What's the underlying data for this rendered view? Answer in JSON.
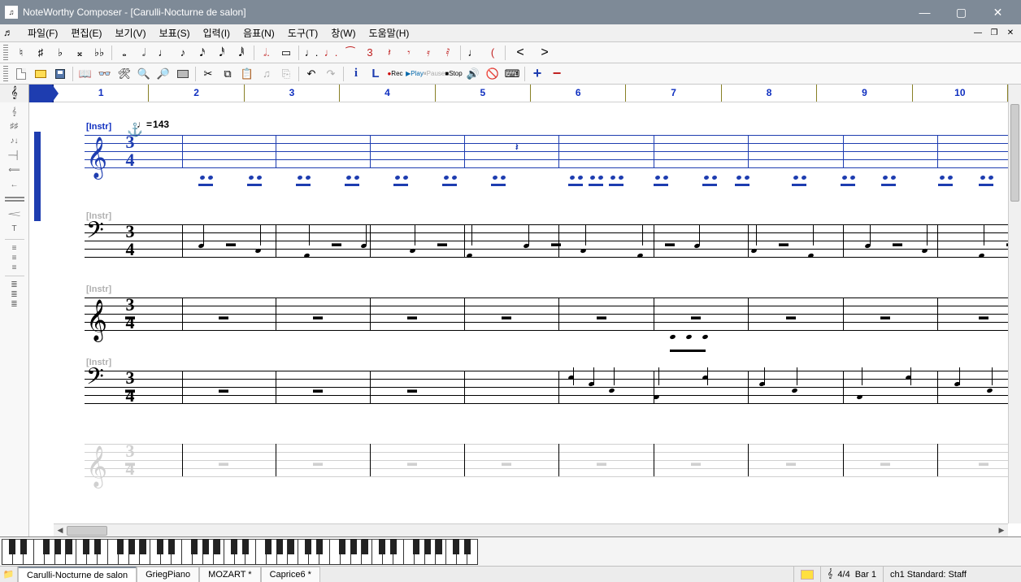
{
  "window": {
    "title": "NoteWorthy Composer - [Carulli-Nocturne de salon]"
  },
  "menu": {
    "items": [
      "파일(F)",
      "편집(E)",
      "보기(V)",
      "보표(S)",
      "입력(I)",
      "음표(N)",
      "도구(T)",
      "창(W)",
      "도움말(H)"
    ]
  },
  "notation_toolbar": {
    "natural": "♮",
    "sharp": "♯",
    "flat": "♭",
    "dbl_sharp": "𝄪",
    "dbl_flat": "♭♭",
    "whole_note": "𝅝",
    "half_note": "𝅗𝅥",
    "quarter_note": "♩",
    "eighth_note": "♪",
    "sixteenth_note": "𝅘𝅥𝅯",
    "thirtysecond_note": "𝅘𝅥𝅰",
    "sixtyfourth_note": "𝅘𝅥𝅱",
    "dot_half": "𝅗𝅥.",
    "rect": "▭",
    "dotted_q": "♩.",
    "dotted_q_red": "♩.",
    "tie": "⁀",
    "triplet": "3",
    "rest1": "𝄽",
    "rest2": "𝄾",
    "rest3": "𝄿",
    "rest4": "𝅀",
    "slur_up": "(",
    "accent": ">",
    "cresc": "<",
    "decresc": ">"
  },
  "file_toolbar": {
    "new": "new",
    "open": "open",
    "save": "save",
    "book": "📖",
    "glasses": "👓",
    "tools": "🛠",
    "find": "🔍",
    "find_page": "🔎",
    "print": "print",
    "cut": "✂",
    "copy": "⧉",
    "paste": "📋",
    "note_entry": "♫",
    "link": "⎘",
    "undo": "↶",
    "redo": "↷",
    "info": "i",
    "L": "L",
    "Rec": "Rec",
    "Play": "Play",
    "Pause": "Pause",
    "Stop": "Stop",
    "speaker": "🔊",
    "mute": "🚫",
    "piano_icon": "⌨",
    "plus": "+",
    "minus": "−"
  },
  "ruler": {
    "measures": [
      "1",
      "2",
      "3",
      "4",
      "5",
      "6",
      "7",
      "8",
      "9",
      "10"
    ]
  },
  "score": {
    "tempo": "143",
    "staves": [
      {
        "label": "[Instr]",
        "clef": "treble",
        "time_top": "3",
        "time_bot": "4",
        "selected": true
      },
      {
        "label": "[Instr]",
        "clef": "bass",
        "time_top": "3",
        "time_bot": "4",
        "selected": false
      },
      {
        "label": "[Instr]",
        "clef": "treble",
        "time_top": "3",
        "time_bot": "4",
        "selected": false
      },
      {
        "label": "[Instr]",
        "clef": "bass",
        "time_top": "3",
        "time_bot": "4",
        "selected": false
      },
      {
        "label": "",
        "clef": "treble",
        "time_top": "3",
        "time_bot": "4",
        "selected": false,
        "ghost": true
      }
    ]
  },
  "tabs": {
    "icon": "📁",
    "docs": [
      {
        "name": "Carulli-Nocturne de salon",
        "modified": false,
        "active": true
      },
      {
        "name": "GriegPiano",
        "modified": false,
        "active": false
      },
      {
        "name": "MOZART *",
        "modified": true,
        "active": false
      },
      {
        "name": "Caprice6 *",
        "modified": true,
        "active": false
      }
    ]
  },
  "status": {
    "time_sig": "4/4",
    "position": "Bar 1",
    "channel": "ch1 Standard: Staff"
  },
  "chart_data": {
    "type": "table",
    "title": "Visible score metadata",
    "rows": [
      {
        "staff": 1,
        "clef": "treble",
        "time": "3/4",
        "tempo": 143,
        "selected": true
      },
      {
        "staff": 2,
        "clef": "bass",
        "time": "3/4"
      },
      {
        "staff": 3,
        "clef": "treble",
        "time": "3/4"
      },
      {
        "staff": 4,
        "clef": "bass",
        "time": "3/4"
      },
      {
        "staff": 5,
        "clef": "treble",
        "time": "3/4",
        "ghost": true
      }
    ],
    "measures_visible": [
      1,
      2,
      3,
      4,
      5,
      6,
      7,
      8,
      9,
      10
    ]
  }
}
